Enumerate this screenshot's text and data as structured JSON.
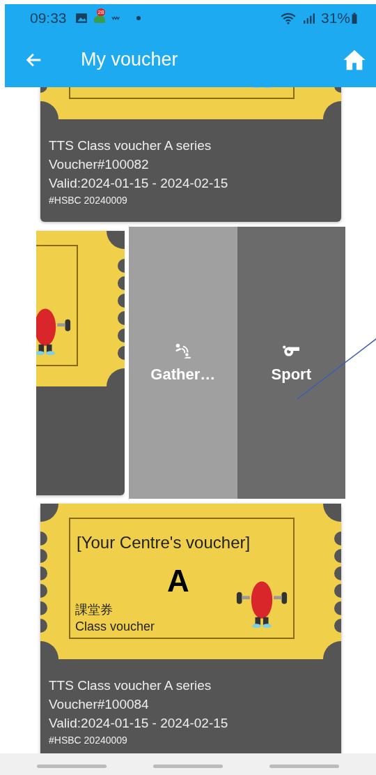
{
  "status_bar": {
    "time": "09:33",
    "badge": "28",
    "battery": "31%"
  },
  "app_bar": {
    "title": "My voucher"
  },
  "vouchers": [
    {
      "swiped": false,
      "title": "TTS Class voucher A series",
      "number": "Voucher#100082",
      "validity": "Valid:2024-01-15 - 2024-02-15",
      "reference": "#HSBC 20240009"
    },
    {
      "swiped": true,
      "actions": [
        {
          "kind": "gather",
          "label": "Gather…"
        },
        {
          "kind": "sport",
          "label": "Sport"
        }
      ]
    },
    {
      "swiped": false,
      "ticket": {
        "heading": "[Your Centre's voucher]",
        "grade": "A",
        "chinese": "課堂券",
        "caption": "Class voucher"
      },
      "title": "TTS Class voucher A series",
      "number": "Voucher#100084",
      "validity": "Valid:2024-01-15 - 2024-02-15",
      "reference": "#HSBC 20240009"
    }
  ]
}
